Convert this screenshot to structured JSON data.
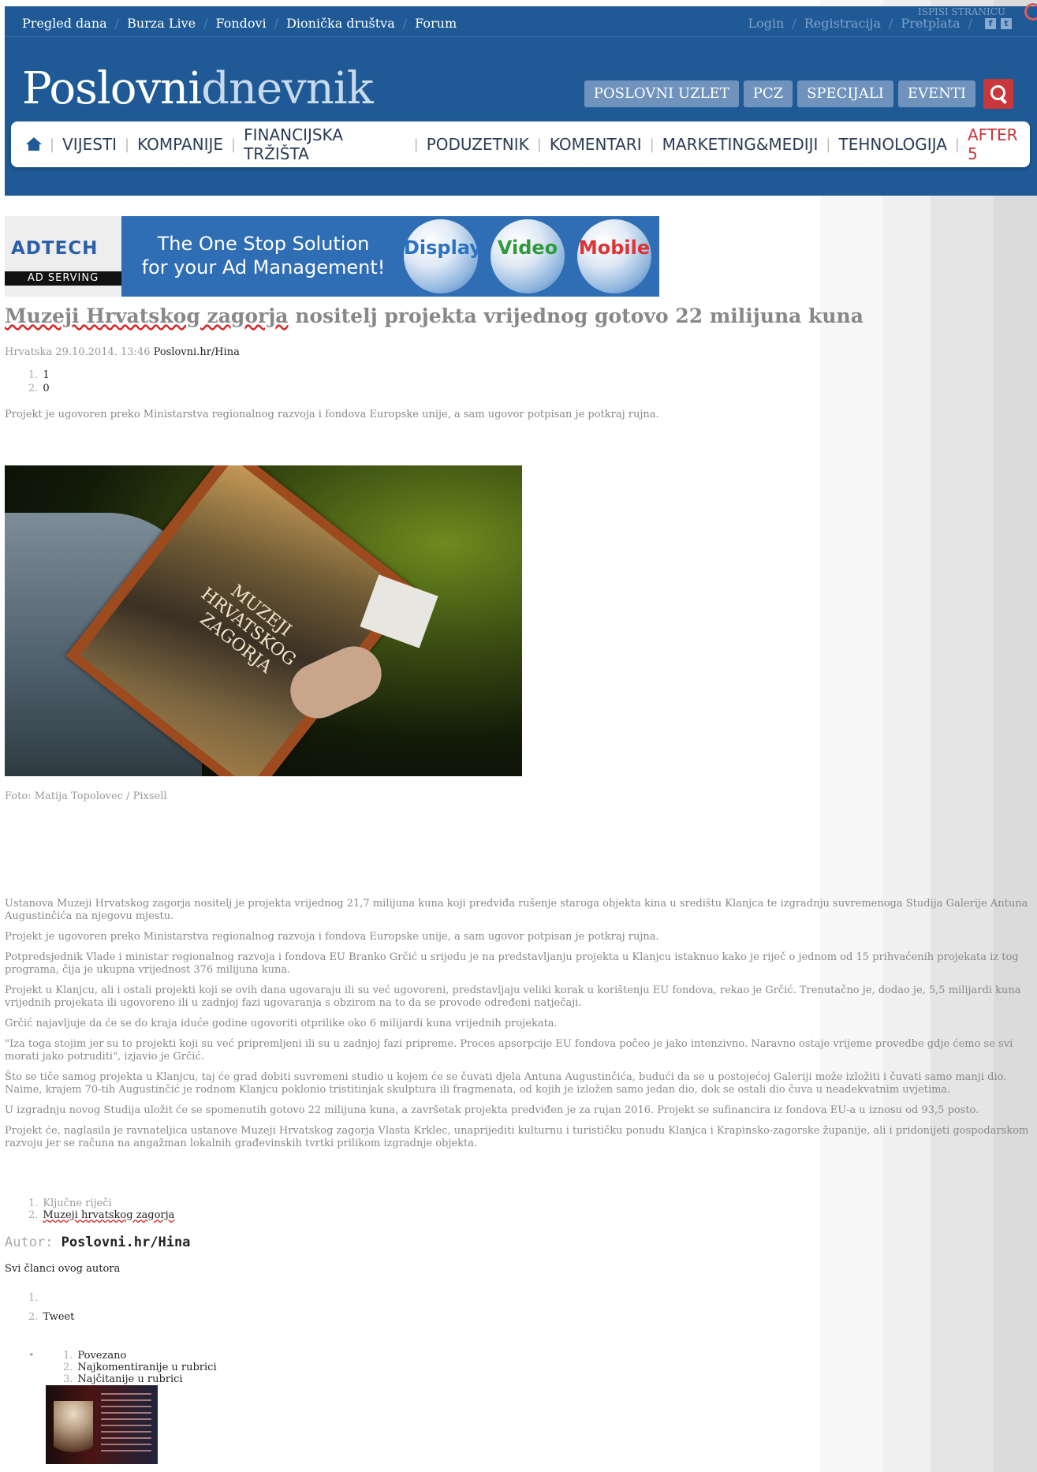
{
  "topbar": {
    "items": [
      "Pregled dana",
      "Burza Live",
      "Fondovi",
      "Dionička društva",
      "Forum"
    ],
    "login": "Login",
    "register": "Registracija",
    "subscribe": "Pretplata",
    "print": "ISPISI STRANICU"
  },
  "logo": {
    "first": "Poslovni",
    "second": "dnevnik"
  },
  "header_buttons": [
    "POSLOVNI UZLET",
    "PCZ",
    "SPECIJALI",
    "EVENTI"
  ],
  "nav": [
    "VIJESTI",
    "KOMPANIJE",
    "FINANCIJSKA TRŽIŠTA",
    "PODUZETNIK",
    "KOMENTARI",
    "MARKETING&MEDIJI",
    "TEHNOLOGIJA",
    "AFTER 5"
  ],
  "ad": {
    "brand": "ADTECH",
    "sub": "AD SERVING",
    "line1": "The One Stop Solution",
    "line2": "for your Ad Management!",
    "balls": [
      "Display",
      "Video",
      "Mobile"
    ]
  },
  "article": {
    "title_part1": "Muzeji Hrvatskog zagorja",
    "title_part2": " nositelj projekta vrijednog gotovo 22 milijuna kuna",
    "meta": "Hrvatska 29.10.2014. 13:46 ",
    "source": "Poslovni.hr/Hina",
    "counters": [
      "1",
      "0"
    ],
    "lead": "Projekt je ugovoren preko Ministarstva regionalnog razvoja i fondova Europske unije, a sam ugovor potpisan je potkraj rujna.",
    "photo_title": "MUZEJI HRVATSKOG ZAGORJA",
    "caption": "Foto: Matija Topolovec / Pixsell",
    "paragraphs": [
      "Ustanova Muzeji Hrvatskog zagorja nositelj je projekta vrijednog 21,7 milijuna kuna koji predviđa rušenje staroga objekta kina u središtu Klanjca te izgradnju suvremenoga Studija Galerije Antuna Augustinčića na njegovu mjestu.",
      "Projekt je ugovoren preko Ministarstva regionalnog razvoja i fondova Europske unije, a sam ugovor potpisan je potkraj rujna.",
      "Potpredsjednik Vlade i ministar regionalnog razvoja i fondova EU Branko Grčić u srijedu je na predstavljanju projekta u Klanjcu istaknuo kako je riječ o jednom od 15 prihvaćenih projekata iz tog programa, čija je ukupna vrijednost 376 milijuna kuna.",
      "Projekt u Klanjcu, ali i ostali projekti koji se ovih dana ugovaraju ili su već ugovoreni, predstavljaju veliki korak u korištenju EU fondova, rekao je Grčić. Trenutačno je, dodao je, 5,5 milijardi kuna vrijednih projekata ili ugovoreno ili u zadnjoj fazi ugovaranja s obzirom na to da se provode određeni natječaji.",
      "Grčić najavljuje da će se do kraja iduće godine ugovoriti otprilike oko 6 milijardi kuna vrijednih projekata.",
      "\"Iza toga stojim jer su to projekti koji su već pripremljeni ili su u zadnjoj fazi pripreme. Proces apsorpcije EU fondova počeo je jako intenzivno. Naravno ostaje vrijeme provedbe gdje ćemo se svi morati jako potruditi\", izjavio je Grčić.",
      "Što se tiče samog projekta u Klanjcu, taj će grad dobiti suvremeni studio u kojem će se čuvati djela Antuna Augustinčića, budući da se u postojećoj Galeriji može izložiti i čuvati samo manji dio. Naime, krajem 70-tih Augustinčić je rodnom Klanjcu poklonio tristitinjak skulptura ili fragmenata, od kojih je izložen samo jedan dio, dok se ostali dio čuva u neadekvatnim uvjetima.",
      "U izgradnju novog Studija uložit će se spomenutih gotovo 22 milijuna kuna, a završetak projekta predviđen je za rujan 2016. Projekt se sufinancira iz fondova EU-a u iznosu od 93,5 posto.",
      "Projekt će, naglasila je ravnateljica ustanove Muzeji Hrvatskog zagorja Vlasta Krklec, unaprijediti kulturnu i turističku ponudu Klanjca i Krapinsko-zagorske županije, ali i pridonijeti gospodarskom razvoju jer se računa na angažman lokalnih građevinskih tvrtki prilikom izgradnje objekta."
    ],
    "tags_label": "Ključne riječi",
    "tag": "Muzeji hrvatskog zagorja",
    "author_label": "Autor: ",
    "author": "Poslovni.hr/Hina",
    "all_articles": "Svi članci ovog autora",
    "share": [
      "",
      "Tweet"
    ],
    "related": [
      "Povezano",
      "Najkomentiranije u rubrici",
      "Najčitanije u rubrici"
    ]
  },
  "colors": {
    "header_blue": "#1f5a96",
    "accent_red": "#c8373a"
  }
}
